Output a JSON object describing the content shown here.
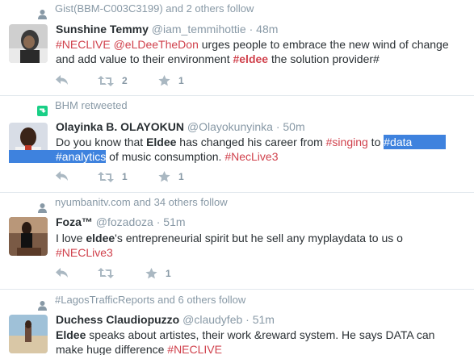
{
  "tweets": [
    {
      "context": "Gist(BBM-C003C3199) and 2 others follow",
      "fullname": "Sunshine Temmy",
      "handle": "@iam_temmihottie",
      "separator": "·",
      "time": "48m",
      "text": {
        "t1": "#NECLIVE",
        "t2": " ",
        "t3": "@eLDeeTheDon",
        "t4": " urges people to embrace the new wind of change and add value to their environment ",
        "t5": "#eldee",
        "t6": " the solution provider#"
      },
      "retweets": "2",
      "favorites": "1"
    },
    {
      "context": "BHM retweeted",
      "fullname": "Olayinka B. OLAYOKUN",
      "handle": "@Olayokunyinka",
      "separator": "·",
      "time": "50m",
      "text": {
        "t1": "Do you know that ",
        "t2": "Eldee",
        "t3": " has changed his career from ",
        "t4": "#singing",
        "t5": " to ",
        "t6": "#data",
        "t7": "#analytics",
        "t8": " of music consumption. ",
        "t9": "#NecLive3"
      },
      "retweets": "1",
      "favorites": "1"
    },
    {
      "context": "nyumbanitv.com and 34 others follow",
      "fullname": "Foza™",
      "handle": "@fozadoza",
      "separator": "·",
      "time": "51m",
      "text": {
        "t1": "I love ",
        "t2": "eldee",
        "t3": "'s entrepreneurial spirit but he sell any myplaydata to us o",
        "t4": "#NECLive3"
      },
      "retweets": "",
      "favorites": "1"
    },
    {
      "context": "#LagosTrafficReports and 6 others follow",
      "fullname": "Duchess Claudiopuzzo",
      "handle": "@claudyfeb",
      "separator": "·",
      "time": "51m",
      "text": {
        "t1": "Eldee",
        "t2": " speaks about artistes, their work &reward system. He says DATA can make huge difference ",
        "t3": "#NECLIVE"
      }
    }
  ],
  "colors": {
    "hashtag": "#d0414c",
    "muted": "#8899a6",
    "retweet_green": "#19cf86",
    "selection": "#3e82de"
  },
  "icons": [
    "follow-icon",
    "retweet-icon",
    "reply-icon",
    "favorite-icon"
  ]
}
